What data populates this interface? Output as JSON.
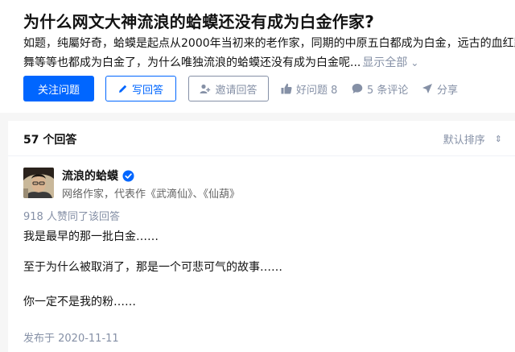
{
  "question": {
    "title": "为什么网文大神流浪的蛤蟆还没有成为白金作家?",
    "detail_line1": "如题，纯屬好奇，蛤蟆是起点从2000年当初来的老作家，同期的中原五白都成为白金，远古的血红跳",
    "detail_line2": "舞等等也都成为白金了，为什么唯独流浪的蛤蟆还没有成为白金呢...",
    "show_all": "显示全部",
    "show_all_icon": "chevron-down-icon"
  },
  "actions": {
    "follow": "关注问题",
    "write_answer": "写回答",
    "invite": "邀请回答",
    "good_question": "好问题 8",
    "comments": "5 条评论",
    "share": "分享"
  },
  "answers": {
    "count": "57 个回答",
    "sort": "默认排序",
    "sort_icon": "sort-updown-icon"
  },
  "answer": {
    "author_name": "流浪的蛤蟆",
    "author_bio": "网络作家，代表作《武滴仙》、《仙葫》",
    "voters": "918 人赞同了该回答",
    "paragraphs": [
      "我是最早的那一批白金……",
      "至于为什么被取消了，那是一个可悲可气的故事……",
      "你一定不是我的粉……"
    ],
    "published": "发布于 2020-11-11"
  },
  "colors": {
    "brand_blue": "#0066ff",
    "gray_text": "#8590a6",
    "page_bg": "#f6f6f6"
  }
}
